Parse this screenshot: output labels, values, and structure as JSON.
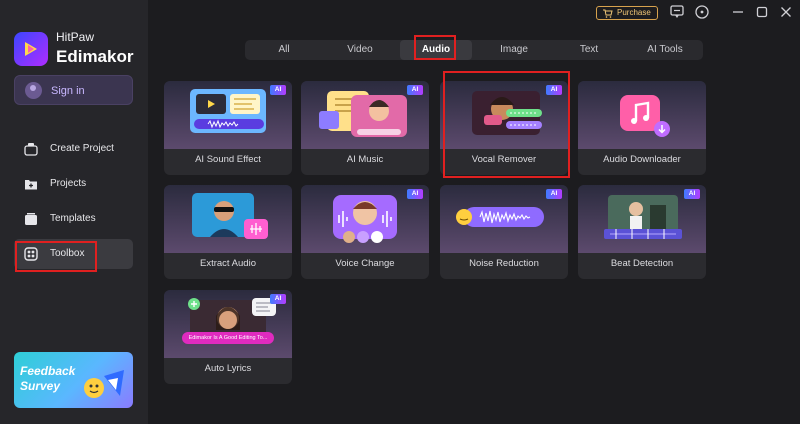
{
  "app": {
    "brand_top": "HitPaw",
    "brand": "Edimakor",
    "sign_in": "Sign in"
  },
  "sidebar": {
    "items": [
      {
        "label": "Create Project",
        "icon": "home-icon"
      },
      {
        "label": "Projects",
        "icon": "folder-plus-icon"
      },
      {
        "label": "Templates",
        "icon": "templates-icon"
      },
      {
        "label": "Toolbox",
        "icon": "toolbox-icon"
      }
    ],
    "active": "Toolbox",
    "survey": {
      "line1": "Feedback",
      "line2": "Survey"
    }
  },
  "topbar": {
    "purchase": "Purchase",
    "icons": [
      "chat-icon",
      "info-icon",
      "minimize-icon",
      "maximize-icon",
      "close-icon"
    ]
  },
  "tabs": [
    "All",
    "Video",
    "Audio",
    "Image",
    "Text",
    "AI Tools"
  ],
  "active_tab": "Audio",
  "badge": "AI",
  "tools": [
    {
      "label": "AI Sound Effect",
      "ai": true
    },
    {
      "label": "AI Music",
      "ai": true
    },
    {
      "label": "Vocal Remover",
      "ai": true
    },
    {
      "label": "Audio Downloader",
      "ai": false
    },
    {
      "label": "Extract Audio",
      "ai": false
    },
    {
      "label": "Voice Change",
      "ai": true
    },
    {
      "label": "Noise Reduction",
      "ai": true
    },
    {
      "label": "Beat Detection",
      "ai": true
    },
    {
      "label": "Auto Lyrics",
      "ai": true
    }
  ],
  "auto_lyrics_caption": "Edimakor Is A Good Editing To...",
  "colors": {
    "accent": "#a47bff",
    "highlight": "#e02020",
    "purchase": "#d7a24d"
  }
}
